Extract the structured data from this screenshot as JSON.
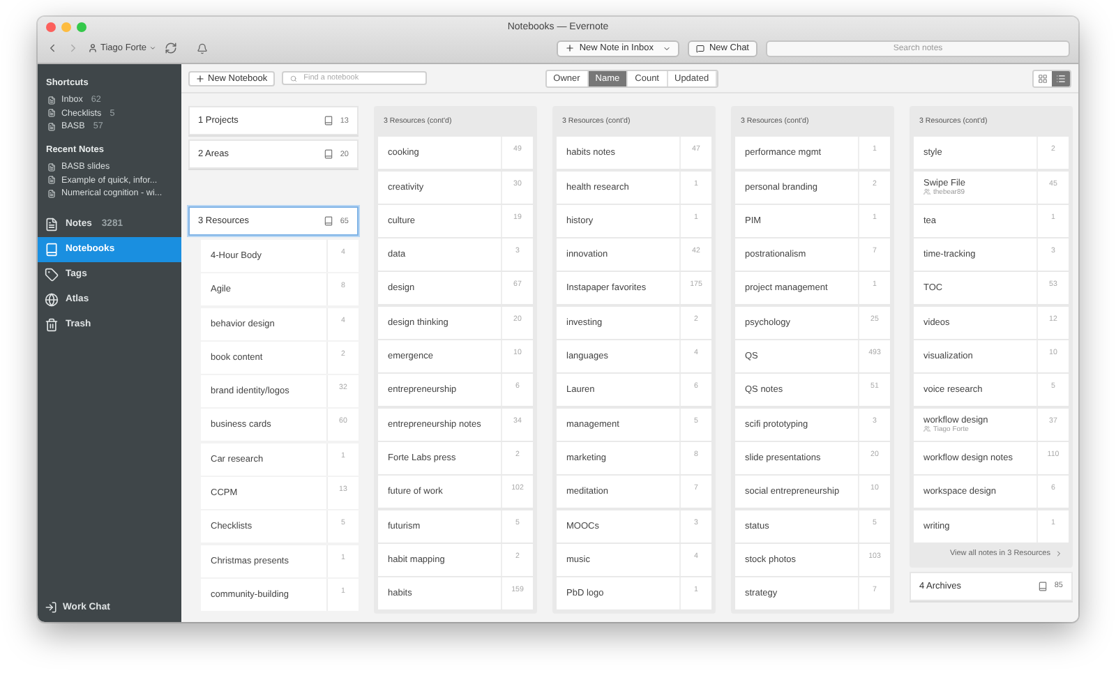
{
  "window": {
    "title": "Notebooks — Evernote"
  },
  "toolbar": {
    "user": "Tiago Forte",
    "new_note": "New Note in Inbox",
    "new_chat": "New Chat",
    "search": {
      "placeholder": "Search notes"
    }
  },
  "sidebar": {
    "shortcuts_heading": "Shortcuts",
    "shortcuts": [
      {
        "label": "Inbox",
        "count": "62"
      },
      {
        "label": "Checklists",
        "count": "5"
      },
      {
        "label": "BASB",
        "count": "57"
      }
    ],
    "recent_heading": "Recent Notes",
    "recent_notes": [
      "BASB slides",
      "Example of quick, infor...",
      "Numerical cognition - wi..."
    ],
    "nav": [
      {
        "kind": "notes",
        "label": "Notes",
        "count": "3281",
        "selected": false
      },
      {
        "kind": "notebooks",
        "label": "Notebooks",
        "selected": true
      },
      {
        "kind": "tags",
        "label": "Tags",
        "selected": false
      },
      {
        "kind": "atlas",
        "label": "Atlas",
        "selected": false
      },
      {
        "kind": "trash",
        "label": "Trash",
        "selected": false
      }
    ],
    "work_chat": "Work Chat"
  },
  "notebook_bar": {
    "new_notebook": "New Notebook",
    "find": {
      "placeholder": "Find a notebook"
    },
    "sort": [
      {
        "label": "Owner",
        "selected": false
      },
      {
        "label": "Name",
        "selected": true
      },
      {
        "label": "Count",
        "selected": false
      },
      {
        "label": "Updated",
        "selected": false
      }
    ],
    "views": [
      {
        "kind": "grid",
        "selected": false
      },
      {
        "kind": "list",
        "selected": true
      }
    ]
  },
  "columns": [
    {
      "blocks": [
        {
          "kind": "stack",
          "name": "1 Projects",
          "count": "13",
          "selected": false
        },
        {
          "kind": "stack",
          "name": "2 Areas",
          "count": "20",
          "selected": false
        },
        {
          "kind": "stack",
          "name": "3 Resources",
          "count": "65",
          "selected": true,
          "notebooks": [
            {
              "name": "4-Hour Body",
              "count": "4"
            },
            {
              "name": "Agile",
              "count": "8"
            },
            {
              "name": "behavior design",
              "count": "4"
            },
            {
              "name": "book content",
              "count": "2"
            },
            {
              "name": "brand identity/logos",
              "count": "32"
            },
            {
              "name": "business cards",
              "count": "60"
            },
            {
              "name": "Car research",
              "count": "1"
            },
            {
              "name": "CCPM",
              "count": "13"
            },
            {
              "name": "Checklists",
              "count": "5"
            },
            {
              "name": "Christmas presents",
              "count": "1"
            },
            {
              "name": "community-building",
              "count": "1"
            }
          ]
        }
      ]
    },
    {
      "blocks": [
        {
          "kind": "panel",
          "header": "3 Resources (cont'd)",
          "notebooks": [
            {
              "name": "cooking",
              "count": "49"
            },
            {
              "name": "creativity",
              "count": "30"
            },
            {
              "name": "culture",
              "count": "19"
            },
            {
              "name": "data",
              "count": "3"
            },
            {
              "name": "design",
              "count": "67"
            },
            {
              "name": "design thinking",
              "count": "20"
            },
            {
              "name": "emergence",
              "count": "10"
            },
            {
              "name": "entrepreneurship",
              "count": "6"
            },
            {
              "name": "entrepreneurship notes",
              "count": "34"
            },
            {
              "name": "Forte Labs press",
              "count": "2"
            },
            {
              "name": "future of work",
              "count": "102"
            },
            {
              "name": "futurism",
              "count": "5"
            },
            {
              "name": "habit mapping",
              "count": "2"
            },
            {
              "name": "habits",
              "count": "159"
            }
          ]
        }
      ]
    },
    {
      "blocks": [
        {
          "kind": "panel",
          "header": "3 Resources (cont'd)",
          "notebooks": [
            {
              "name": "habits notes",
              "count": "47"
            },
            {
              "name": "health research",
              "count": "1"
            },
            {
              "name": "history",
              "count": "1"
            },
            {
              "name": "innovation",
              "count": "42"
            },
            {
              "name": "Instapaper favorites",
              "count": "175"
            },
            {
              "name": "investing",
              "count": "2"
            },
            {
              "name": "languages",
              "count": "4"
            },
            {
              "name": "Lauren",
              "count": "6"
            },
            {
              "name": "management",
              "count": "5"
            },
            {
              "name": "marketing",
              "count": "8"
            },
            {
              "name": "meditation",
              "count": "7"
            },
            {
              "name": "MOOCs",
              "count": "3"
            },
            {
              "name": "music",
              "count": "4"
            },
            {
              "name": "PbD logo",
              "count": "1"
            }
          ]
        }
      ]
    },
    {
      "blocks": [
        {
          "kind": "panel",
          "header": "3 Resources (cont'd)",
          "notebooks": [
            {
              "name": "performance mgmt",
              "count": "1"
            },
            {
              "name": "personal branding",
              "count": "2"
            },
            {
              "name": "PIM",
              "count": "1"
            },
            {
              "name": "postrationalism",
              "count": "7"
            },
            {
              "name": "project management",
              "count": "1"
            },
            {
              "name": "psychology",
              "count": "25"
            },
            {
              "name": "QS",
              "count": "493"
            },
            {
              "name": "QS notes",
              "count": "51"
            },
            {
              "name": "scifi prototyping",
              "count": "3"
            },
            {
              "name": "slide presentations",
              "count": "20"
            },
            {
              "name": "social entrepreneurship",
              "count": "10"
            },
            {
              "name": "status",
              "count": "5"
            },
            {
              "name": "stock photos",
              "count": "103"
            },
            {
              "name": "strategy",
              "count": "7"
            }
          ]
        }
      ]
    },
    {
      "blocks": [
        {
          "kind": "panel",
          "header": "3 Resources (cont'd)",
          "footer": "View all notes in 3 Resources",
          "notebooks": [
            {
              "name": "style",
              "count": "2"
            },
            {
              "name": "Swipe File",
              "count": "45",
              "owner": "thebear89"
            },
            {
              "name": "tea",
              "count": "1"
            },
            {
              "name": "time-tracking",
              "count": "3"
            },
            {
              "name": "TOC",
              "count": "53"
            },
            {
              "name": "videos",
              "count": "12"
            },
            {
              "name": "visualization",
              "count": "10"
            },
            {
              "name": "voice research",
              "count": "5"
            },
            {
              "name": "workflow design",
              "count": "37",
              "owner": "Tiago Forte"
            },
            {
              "name": "workflow design notes",
              "count": "110"
            },
            {
              "name": "workspace design",
              "count": "6"
            },
            {
              "name": "writing",
              "count": "1"
            }
          ]
        },
        {
          "kind": "stack",
          "name": "4 Archives",
          "count": "85",
          "selected": false
        }
      ]
    }
  ]
}
